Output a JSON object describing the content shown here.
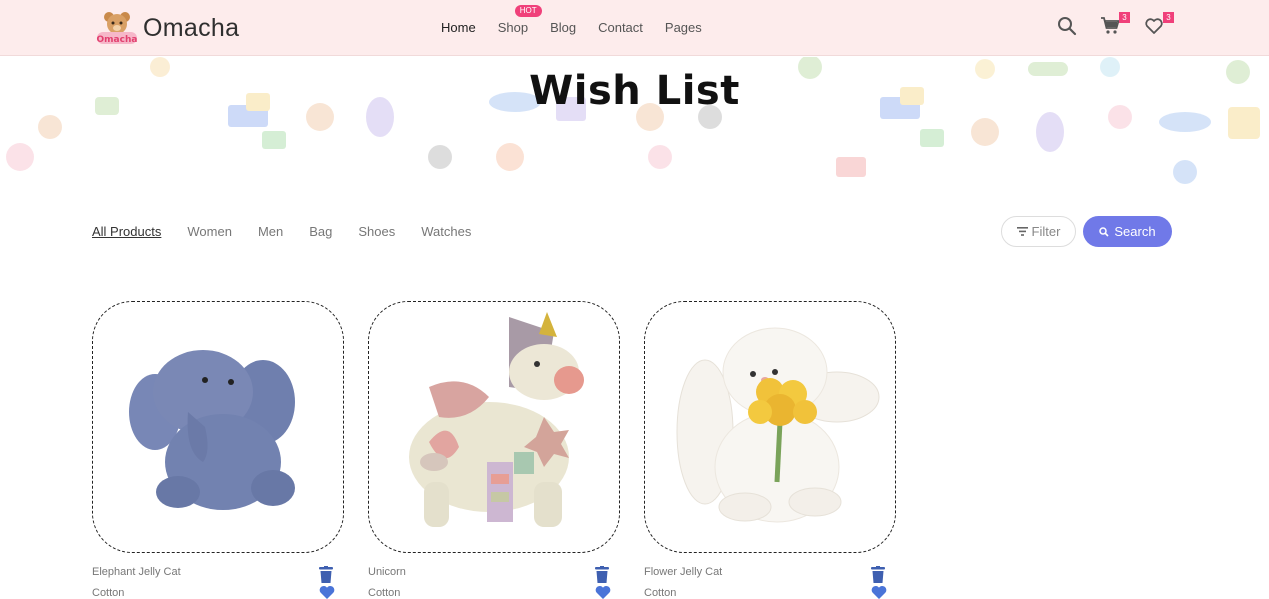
{
  "header": {
    "brand": "Omacha",
    "nav": [
      {
        "label": "Home",
        "active": true
      },
      {
        "label": "Shop",
        "badge": "HOT"
      },
      {
        "label": "Blog"
      },
      {
        "label": "Contact"
      },
      {
        "label": "Pages"
      }
    ],
    "cart_count": "3",
    "wishlist_count": "3"
  },
  "banner": {
    "title": "Wish List"
  },
  "categories": [
    "All Products",
    "Women",
    "Men",
    "Bag",
    "Shoes",
    "Watches"
  ],
  "filter_label": "Filter",
  "search_label": "Search",
  "products": [
    {
      "name": "Elephant Jelly Cat",
      "material": "Cotton",
      "image": "elephant-plush"
    },
    {
      "name": "Unicorn",
      "material": "Cotton",
      "image": "unicorn-plush"
    },
    {
      "name": "Flower Jelly Cat",
      "material": "Cotton",
      "image": "bunny-plush"
    }
  ],
  "colors": {
    "header_bg": "#fdecec",
    "accent": "#7079e8",
    "badge": "#f0407a",
    "icon_blue": "#3e5fb0"
  }
}
